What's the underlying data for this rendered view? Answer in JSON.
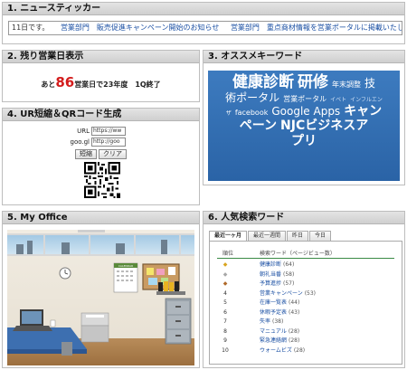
{
  "ticker": {
    "title": "1. ニュースティッカー",
    "date": "11日です。",
    "items": [
      "営業部門　販売促進キャンペーン開始のお知らせ",
      "営業部門　重点商材情報を営業ポータルに掲載いたしま"
    ]
  },
  "remaining_days": {
    "title": "2. 残り営業日表示",
    "prefix": "あと",
    "number": "86",
    "suffix": "営業日で23年度　1Q終了"
  },
  "keywords": {
    "title": "3. オススメキーワード",
    "words": [
      "健康診断",
      "研修",
      "年末調整",
      "技",
      "術ポータル",
      "営業ポータル",
      "イベト",
      "インフルエン",
      "ザ",
      "facebook",
      "Google Apps",
      "キャン",
      "ペーン",
      "NJCビジネスア",
      "プリ"
    ]
  },
  "qr_tool": {
    "title": "4. UR短縮＆QRコード生成",
    "url_label": "URL",
    "url_value": "https://ww",
    "googl_label": "goo.gl",
    "googl_value": "http://goo",
    "shorten_button": "短縮",
    "clear_button": "クリア"
  },
  "office": {
    "title": "5. My Office",
    "calendar_label": "CALENDAR"
  },
  "search_ranking": {
    "title": "6. 人気検索ワード",
    "tabs": [
      "最近一ヶ月",
      "最近一週間",
      "昨日",
      "今日"
    ],
    "col_rank": "順位",
    "col_word": "検索ワード（ページビュー数）",
    "rows": [
      {
        "rank": "1",
        "word": "健康診断",
        "count": "(64)"
      },
      {
        "rank": "2",
        "word": "朝礼当番",
        "count": "(58)"
      },
      {
        "rank": "3",
        "word": "予算進捗",
        "count": "(57)"
      },
      {
        "rank": "4",
        "word": "営業キャンペーン",
        "count": "(53)"
      },
      {
        "rank": "5",
        "word": "在庫一覧表",
        "count": "(44)"
      },
      {
        "rank": "6",
        "word": "休暇予定表",
        "count": "(43)"
      },
      {
        "rank": "7",
        "word": "失率",
        "count": "(38)"
      },
      {
        "rank": "8",
        "word": "マニュアル",
        "count": "(28)"
      },
      {
        "rank": "9",
        "word": "緊急連絡網",
        "count": "(28)"
      },
      {
        "rank": "10",
        "word": "ウォームビズ",
        "count": "(28)"
      }
    ],
    "colors": {
      "gold": "#d9a520",
      "silver": "#a8a8a8",
      "bronze": "#b06a2a",
      "rule": "#3a8a45",
      "link": "#1a4fa3"
    }
  }
}
